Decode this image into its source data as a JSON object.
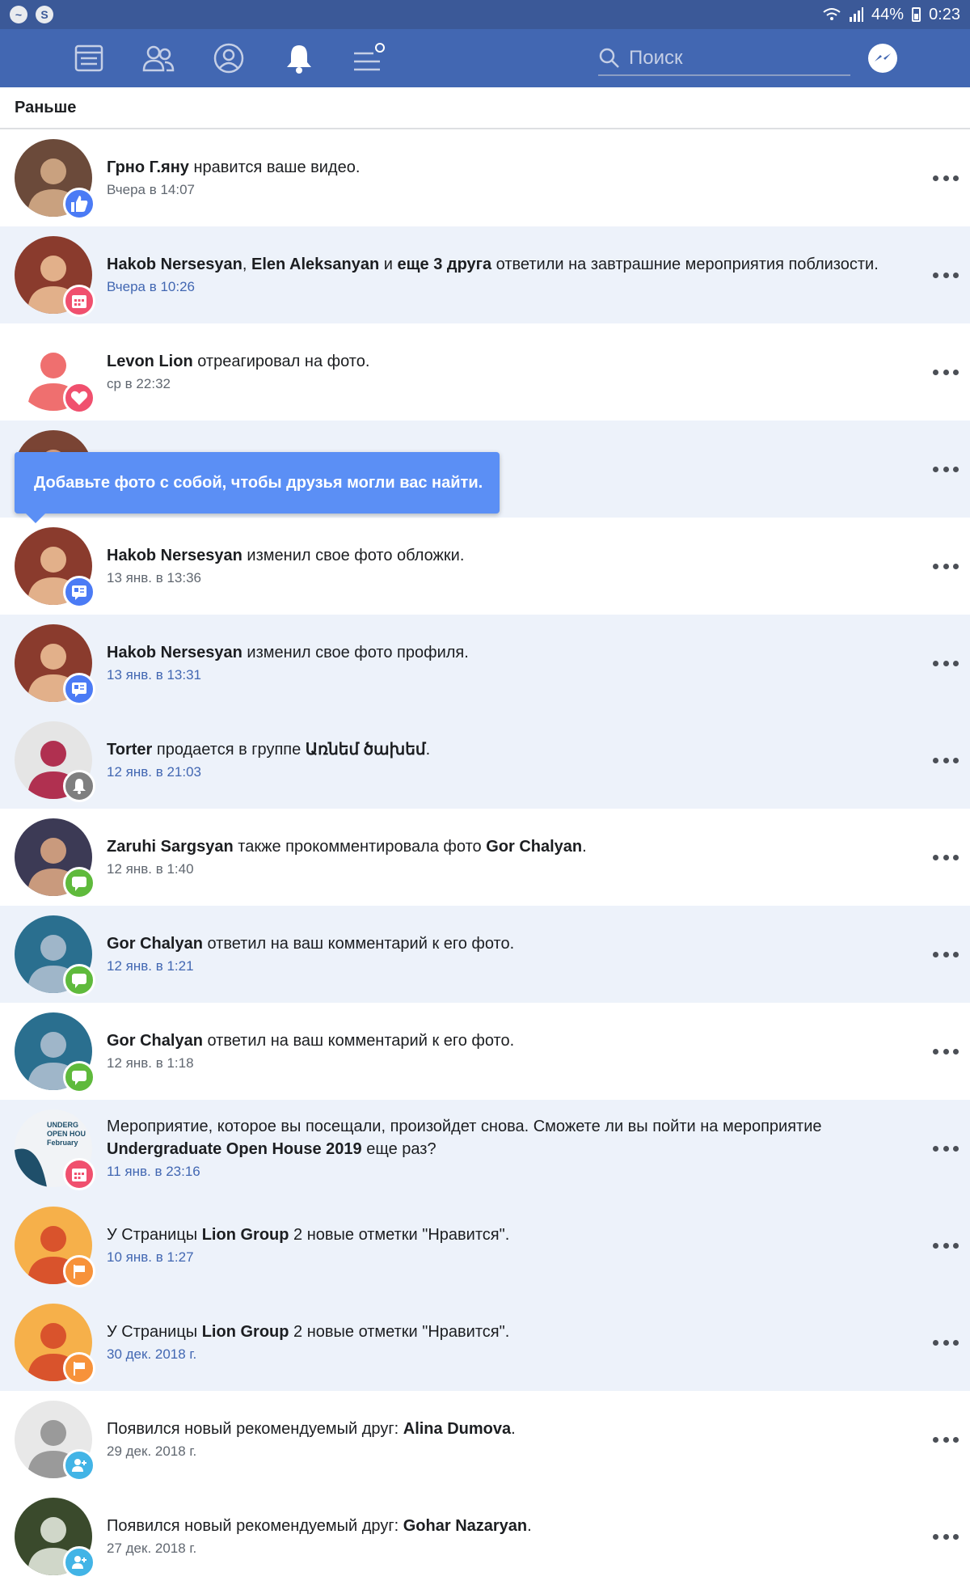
{
  "status": {
    "battery": "44%",
    "time": "0:23"
  },
  "nav": {
    "icons": [
      "news-feed-icon",
      "friends-icon",
      "profile-icon",
      "notifications-bell-icon",
      "menu-icon"
    ],
    "search_placeholder": "Поиск",
    "messenger": "messenger-icon"
  },
  "section": {
    "title": "Раньше"
  },
  "tooltip": {
    "text": "Добавьте фото с собой, чтобы друзья могли вас найти."
  },
  "colors": {
    "nav": "#4267b2",
    "statusbar": "#3b5998",
    "unread_bg": "#edf2fa",
    "link_blue": "#4267b2"
  },
  "notifications": [
    {
      "segments": [
        {
          "t": "Грно Г.яну",
          "b": true
        },
        {
          "t": " нравится ваше видео.",
          "b": false
        }
      ],
      "time": "Вчера в 14:07",
      "badge": "like-icon",
      "unread": false
    },
    {
      "segments": [
        {
          "t": "Hakob Nersesyan",
          "b": true
        },
        {
          "t": ", ",
          "b": false
        },
        {
          "t": "Elen Aleksanyan",
          "b": true
        },
        {
          "t": " и ",
          "b": false
        },
        {
          "t": "еще 3 друга",
          "b": true
        },
        {
          "t": " ответили на завтрашние мероприятия поблизости.",
          "b": false
        }
      ],
      "time": "Вчера в 10:26",
      "badge": "calendar-icon",
      "unread": true
    },
    {
      "segments": [
        {
          "t": "Levon Lion",
          "b": true
        },
        {
          "t": " отреагировал на фото.",
          "b": false
        }
      ],
      "time": "ср в 22:32",
      "badge": "heart-icon",
      "unread": false
    },
    {
      "segments": [],
      "time": "",
      "badge": "",
      "unread": true
    },
    {
      "segments": [
        {
          "t": "Hakob Nersesyan",
          "b": true
        },
        {
          "t": " изменил свое фото обложки.",
          "b": false
        }
      ],
      "time": "13 янв. в 13:36",
      "badge": "status-update-icon",
      "unread": false
    },
    {
      "segments": [
        {
          "t": "Hakob Nersesyan",
          "b": true
        },
        {
          "t": " изменил свое фото профиля.",
          "b": false
        }
      ],
      "time": "13 янв. в 13:31",
      "badge": "status-update-icon",
      "unread": true
    },
    {
      "segments": [
        {
          "t": "Torter",
          "b": true
        },
        {
          "t": " продается в группе ",
          "b": false
        },
        {
          "t": "Առնեմ ծախեմ",
          "b": true
        },
        {
          "t": ".",
          "b": false
        }
      ],
      "time": "12 янв. в 21:03",
      "badge": "bell-icon",
      "unread": true
    },
    {
      "segments": [
        {
          "t": "Zaruhi Sargsyan",
          "b": true
        },
        {
          "t": " также прокомментировала фото ",
          "b": false
        },
        {
          "t": "Gor Chalyan",
          "b": true
        },
        {
          "t": ".",
          "b": false
        }
      ],
      "time": "12 янв. в 1:40",
      "badge": "comment-icon",
      "unread": false
    },
    {
      "segments": [
        {
          "t": "Gor Chalyan",
          "b": true
        },
        {
          "t": " ответил на ваш комментарий к его фото.",
          "b": false
        }
      ],
      "time": "12 янв. в 1:21",
      "badge": "comment-icon",
      "unread": true
    },
    {
      "segments": [
        {
          "t": "Gor Chalyan",
          "b": true
        },
        {
          "t": " ответил на ваш комментарий к его фото.",
          "b": false
        }
      ],
      "time": "12 янв. в 1:18",
      "badge": "comment-icon",
      "unread": false
    },
    {
      "segments": [
        {
          "t": "Мероприятие, которое вы посещали, произойдет снова. Сможете ли вы пойти на мероприятие ",
          "b": false
        },
        {
          "t": "Undergraduate Open House 2019",
          "b": true
        },
        {
          "t": " еще раз?",
          "b": false
        }
      ],
      "time": "11 янв. в 23:16",
      "badge": "calendar-icon",
      "unread": true,
      "avatar_text": "UNDERG OPEN HOU February"
    },
    {
      "segments": [
        {
          "t": "У Страницы ",
          "b": false
        },
        {
          "t": "Lion Group",
          "b": true
        },
        {
          "t": " 2 новые отметки \"Нравится\".",
          "b": false
        }
      ],
      "time": "10 янв. в 1:27",
      "badge": "flag-icon",
      "unread": true
    },
    {
      "segments": [
        {
          "t": "У Страницы ",
          "b": false
        },
        {
          "t": "Lion Group",
          "b": true
        },
        {
          "t": " 2 новые отметки \"Нравится\".",
          "b": false
        }
      ],
      "time": "30 дек. 2018 г.",
      "badge": "flag-icon",
      "unread": true
    },
    {
      "segments": [
        {
          "t": "Появился новый рекомендуемый друг: ",
          "b": false
        },
        {
          "t": "Alina Dumova",
          "b": true
        },
        {
          "t": ".",
          "b": false
        }
      ],
      "time": "29 дек. 2018 г.",
      "badge": "add-friend-icon",
      "unread": false
    },
    {
      "segments": [
        {
          "t": "Появился новый рекомендуемый друг: ",
          "b": false
        },
        {
          "t": "Gohar Nazaryan",
          "b": true
        },
        {
          "t": ".",
          "b": false
        }
      ],
      "time": "27 дек. 2018 г.",
      "badge": "add-friend-icon",
      "unread": false
    }
  ]
}
